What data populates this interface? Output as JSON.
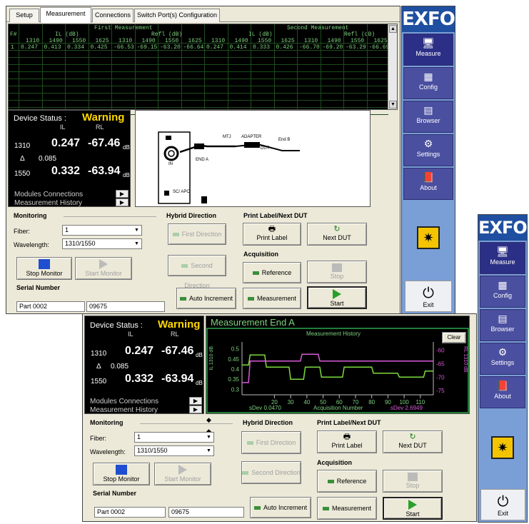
{
  "brand": "EXFO",
  "tabs": [
    "Setup",
    "Measurement",
    "Connections",
    "Switch Port(s) Configuration"
  ],
  "table": {
    "headers": {
      "first": "First Measurement",
      "second": "Second Measurement",
      "il": "IL (dB)",
      "refl": "Refl (dB)",
      "fnum": "F#",
      "wavelengths": [
        "1310",
        "1490",
        "1550",
        "1625",
        "1310",
        "1490",
        "1550",
        "1625",
        "1310",
        "1490",
        "1550",
        "1625",
        "1310",
        "1490",
        "1550",
        "1625"
      ]
    },
    "rows": [
      [
        "1",
        "0.247",
        "0.413",
        "0.334",
        "0.425",
        "-66.53",
        "-69.15",
        "-63.20",
        "-66.64",
        "0.247",
        "0.414",
        "0.333",
        "0.426",
        "-66.70",
        "-69.20",
        "-63.29",
        "-66.69"
      ]
    ]
  },
  "status": {
    "label": "Device Status :",
    "state": "Warning",
    "il_header": "IL",
    "rl_header": "RL",
    "rows": [
      {
        "wl": "1310",
        "il": "0.247",
        "rl": "-67.46",
        "unit": "dB"
      },
      {
        "wl": "1550",
        "il": "0.332",
        "rl": "-63.94",
        "unit": "dB"
      }
    ],
    "delta_symbol": "Δ",
    "delta_value": "0.085",
    "modules_connections": "Modules Connections",
    "measurement_history": "Measurement History"
  },
  "diagram": {
    "mtj": "MTJ",
    "adapter": "ADAPTER",
    "end_b": "End B",
    "end_a": "END A",
    "dut": "DUT",
    "in": "IN",
    "port_label": "SC/ APC"
  },
  "monitoring": {
    "title": "Monitoring",
    "fiber_label": "Fiber:",
    "fiber_value": "1",
    "wavelength_label": "Wavelength:",
    "wavelength_value": "1310/1550",
    "stop_label": "Stop Monitor",
    "start_label": "Start Monitor"
  },
  "hybrid": {
    "title": "Hybrid Direction",
    "first": "First Direction",
    "second": "Second Direction"
  },
  "print": {
    "title": "Print Label/Next DUT",
    "print_label": "Print Label",
    "next_label": "Next DUT"
  },
  "acquisition": {
    "title": "Acquisition",
    "reference": "Reference",
    "measurement": "Measurement",
    "stop": "Stop",
    "start": "Start"
  },
  "serial": {
    "title": "Serial Number",
    "part": "Part 0002",
    "number": "09675",
    "auto_increment": "Auto Increment"
  },
  "sidebar": {
    "measure": "Measure",
    "config": "Config",
    "browser": "Browser",
    "settings": "Settings",
    "about": "About",
    "exit": "Exit"
  },
  "graph": {
    "title": "Measurement End A",
    "subtitle": "Measurement History",
    "clear": "Clear",
    "xlabel": "Acquisition Number",
    "ylabel_left": "IL 1310 dB",
    "ylabel_right": "RL 1310 dB",
    "sdev_left": "sDev 0.0470",
    "sdev_right": "sDev 2.6949",
    "colors": {
      "il": "#7ddb3e",
      "rl": "#d85ad8",
      "frame": "#2aa64a"
    }
  },
  "chart_data": {
    "type": "line",
    "title": "Measurement History",
    "xlabel": "Acquisition Number",
    "ylabel": "IL 1310 dB",
    "y2label": "RL 1310 dB",
    "xlim": [
      0,
      118
    ],
    "ylim": [
      0.28,
      0.52
    ],
    "y2lim": [
      -76,
      -58
    ],
    "xticks": [
      "20",
      "30",
      "40",
      "50",
      "60",
      "70",
      "80",
      "90",
      "100",
      "110"
    ],
    "yticks": [
      "0.5",
      "0.45",
      "0.4",
      "0.35",
      "0.3"
    ],
    "y2ticks": [
      "-60",
      "-65",
      "-70",
      "-75"
    ],
    "series": [
      {
        "name": "IL 1310 dB",
        "axis": "left",
        "x": [
          0,
          4,
          5,
          14,
          15,
          29,
          30,
          38,
          39,
          48,
          49,
          62,
          63,
          80,
          81,
          96,
          97,
          112,
          113,
          118
        ],
        "y": [
          0.42,
          0.42,
          0.47,
          0.47,
          0.41,
          0.41,
          0.35,
          0.35,
          0.41,
          0.41,
          0.36,
          0.36,
          0.41,
          0.41,
          0.38,
          0.38,
          0.36,
          0.36,
          0.39,
          0.39
        ]
      },
      {
        "name": "RL 1310 dB",
        "axis": "right",
        "x": [
          0,
          4,
          5,
          36,
          37,
          47,
          48,
          118
        ],
        "y": [
          -72,
          -72,
          -64,
          -64,
          -61.5,
          -61.5,
          -64,
          -64
        ]
      }
    ]
  }
}
